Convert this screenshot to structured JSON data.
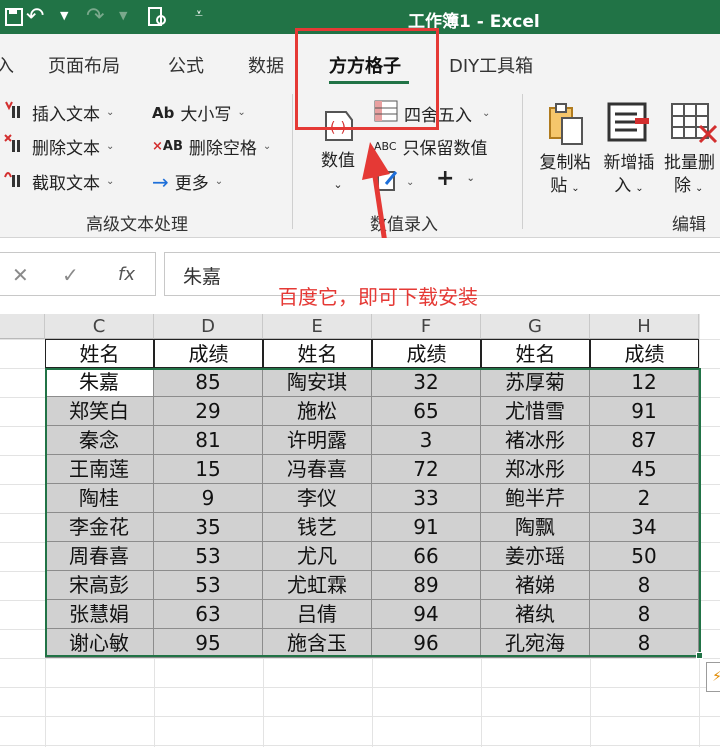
{
  "window": {
    "title": "工作簿1  -  Excel"
  },
  "quick_access": {
    "save_icon": "save-icon",
    "undo_icon": "undo-icon",
    "redo_icon": "redo-icon",
    "print_icon": "print-preview-icon",
    "customize_icon": "customize-qat-icon"
  },
  "tabs": [
    {
      "label": "入"
    },
    {
      "label": "页面布局"
    },
    {
      "label": "公式"
    },
    {
      "label": "数据"
    },
    {
      "label": "方方格子"
    },
    {
      "label": "DIY工具箱"
    }
  ],
  "ribbon": {
    "text_group": {
      "insert_text": "插入文本",
      "delete_text": "删除文本",
      "extract_text": "截取文本",
      "case": "大小写",
      "delete_spaces": "删除空格",
      "more": "更多",
      "label": "高级文本处理"
    },
    "value_group": {
      "value_button": "数值",
      "round": "四舍五入",
      "keep_values": "只保留数值",
      "label": "数值录入"
    },
    "edit_group": {
      "copy_paste_line1": "复制粘",
      "copy_paste_line2": "贴",
      "new_insert_line1": "新增插",
      "new_insert_line2": "入",
      "batch_delete_line1": "批量删",
      "batch_delete_line2": "除",
      "label": "编辑"
    }
  },
  "annotation": {
    "text": "百度它，即可下载安装",
    "color": "#e53935"
  },
  "formula_bar": {
    "cancel": "✕",
    "confirm": "✓",
    "fx": "fx",
    "value": "朱嘉"
  },
  "sheet": {
    "columns": [
      "C",
      "D",
      "E",
      "F",
      "G",
      "H"
    ],
    "header_row": [
      "姓名",
      "成绩",
      "姓名",
      "成绩",
      "姓名",
      "成绩"
    ],
    "rows": [
      [
        "朱嘉",
        "85",
        "陶安琪",
        "32",
        "苏厚菊",
        "12"
      ],
      [
        "郑笑白",
        "29",
        "施松",
        "65",
        "尤惜雪",
        "91"
      ],
      [
        "秦念",
        "81",
        "许明露",
        "3",
        "褚冰彤",
        "87"
      ],
      [
        "王南莲",
        "15",
        "冯春喜",
        "72",
        "郑冰彤",
        "45"
      ],
      [
        "陶桂",
        "9",
        "李仪",
        "33",
        "鲍半芹",
        "2"
      ],
      [
        "李金花",
        "35",
        "钱艺",
        "91",
        "陶飘",
        "34"
      ],
      [
        "周春喜",
        "53",
        "尤凡",
        "66",
        "姜亦瑶",
        "50"
      ],
      [
        "宋高彭",
        "53",
        "尤虹霖",
        "89",
        "褚娣",
        "8"
      ],
      [
        "张慧娟",
        "63",
        "吕倩",
        "94",
        "褚纨",
        "8"
      ],
      [
        "谢心敏",
        "95",
        "施含玉",
        "96",
        "孔宛海",
        "8"
      ]
    ]
  },
  "colors": {
    "excel_green": "#217346",
    "selection_fill": "#d1d1d1",
    "highlight_red": "#e53935"
  }
}
